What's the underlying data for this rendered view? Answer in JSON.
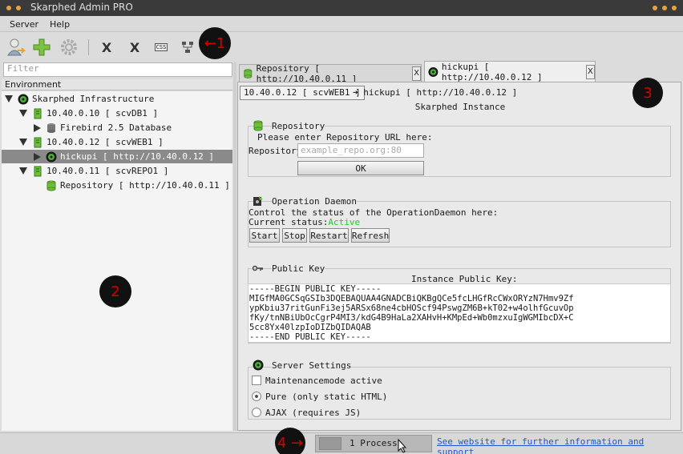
{
  "window": {
    "title": "Skarphed Admin PRO"
  },
  "menu": {
    "items": [
      "Server",
      "Help"
    ]
  },
  "toolbar": {
    "x1": "X",
    "x2": "X",
    "css": "CSS"
  },
  "annotations": {
    "a1": "←1",
    "a2": "2",
    "a3": "3",
    "a4": "4 →"
  },
  "sidebar": {
    "filter_placeholder": "Filter",
    "header": "Environment",
    "tree": [
      {
        "label": "Skarphed Infrastructure"
      },
      {
        "label": "10.40.0.10 [ scvDB1 ]"
      },
      {
        "label": "Firebird 2.5 Database"
      },
      {
        "label": "10.40.0.12 [ scvWEB1 ]"
      },
      {
        "label": "hickupi [ http://10.40.0.12 ]"
      },
      {
        "label": "10.40.0.11 [ scvREPO1 ]"
      },
      {
        "label": "Repository [ http://10.40.0.11 ]"
      }
    ]
  },
  "tabs": [
    {
      "label": "Repository [ http://10.40.0.11 ]",
      "close": "X"
    },
    {
      "label": "hickupi [ http://10.40.0.12 ]",
      "close": "X"
    }
  ],
  "main": {
    "crumb_server": "10.40.0.12 [ scvWEB1 ]",
    "crumb_arrow": "➜ hickupi [ http://10.40.0.12 ]",
    "title": "Skarphed Instance",
    "repository": {
      "heading": "Repository",
      "instruction": "Please enter Repository URL here:",
      "field_label": "Repository",
      "placeholder": "example_repo.org:80",
      "ok": "OK"
    },
    "daemon": {
      "heading": "Operation Daemon",
      "desc": "Control the status of the OperationDaemon here:",
      "status_label": "Current status:",
      "status_value": "Active",
      "buttons": [
        "Start",
        "Stop",
        "Restart",
        "Refresh"
      ]
    },
    "publickey": {
      "heading": "Public Key",
      "label": "Instance Public Key:",
      "lines": [
        "-----BEGIN PUBLIC KEY-----",
        "MIGfMA0GCSqGSIb3DQEBAQUAA4GNADCBiQKBgQCe5fcLHGfRcCWxORYzN7Hmv9Zf",
        "ypKbiu37ritGunFi3ej5ARSx68ne4cbHOScf94PswgZM6B+kT02+w4olhfGcuvOp",
        "fKy/tnNBiUbOcCgrP4MI3/kdG4B9HaLa2XAHvH+KMpEd+Wb0mzxuIgWGMIbcDX+C",
        "5cc8Yx40lzpIoDIZbQIDAQAB",
        "-----END PUBLIC KEY-----"
      ]
    },
    "settings": {
      "heading": "Server Settings",
      "maintenance": "Maintenancemode active",
      "pure": "Pure (only static HTML)",
      "ajax": "AJAX (requires JS)"
    }
  },
  "status": {
    "process": "1 Process",
    "link": "See website for further information and support"
  }
}
